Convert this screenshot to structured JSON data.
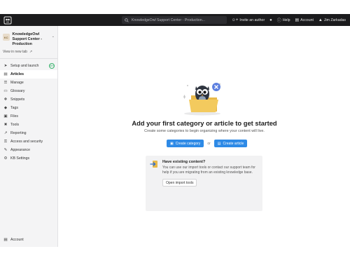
{
  "topbar": {
    "search_placeholder": "KnowledgeOwl Support Center - Production...",
    "invite_label": "Invite an author",
    "help_label": "Help",
    "account_label": "Account",
    "user_label": "Jim Zarkadas"
  },
  "sidebar": {
    "kb_badge": "KC",
    "kb_name": "KnowledgeOwl Support Center - Production",
    "view_new_tab": "View in new tab",
    "items": [
      {
        "label": "Setup and launch",
        "icon": "rocket-icon",
        "badge": "65%"
      },
      {
        "label": "Articles",
        "icon": "document-icon"
      },
      {
        "label": "Manage",
        "icon": "list-icon"
      },
      {
        "label": "Glossary",
        "icon": "book-icon"
      },
      {
        "label": "Snippets",
        "icon": "puzzle-icon"
      },
      {
        "label": "Tags",
        "icon": "tag-icon"
      },
      {
        "label": "Files",
        "icon": "folder-icon"
      },
      {
        "label": "Tools",
        "icon": "wrench-icon"
      },
      {
        "label": "Reporting",
        "icon": "chart-icon"
      },
      {
        "label": "Access and security",
        "icon": "key-icon"
      },
      {
        "label": "Appearance",
        "icon": "brush-icon"
      },
      {
        "label": "KB Settings",
        "icon": "gear-icon"
      }
    ],
    "footer_label": "Account"
  },
  "main": {
    "empty_title": "Add your first category or article to get started",
    "empty_subtitle": "Create some categories to begin organizing where your content will live.",
    "create_category_label": "Create category",
    "or_label": "or",
    "create_article_label": "Create article",
    "import": {
      "title": "Have existing content?",
      "text": "You can use our import tools or contact our support team for help if you are migrating from an existing knowledge base.",
      "button_label": "Open import tools"
    }
  },
  "colors": {
    "topbar": "#1b1b1d",
    "accent": "#2e8ae6",
    "sidebar_bg": "#f4f4f5",
    "progress_green": "#3ab36e"
  }
}
